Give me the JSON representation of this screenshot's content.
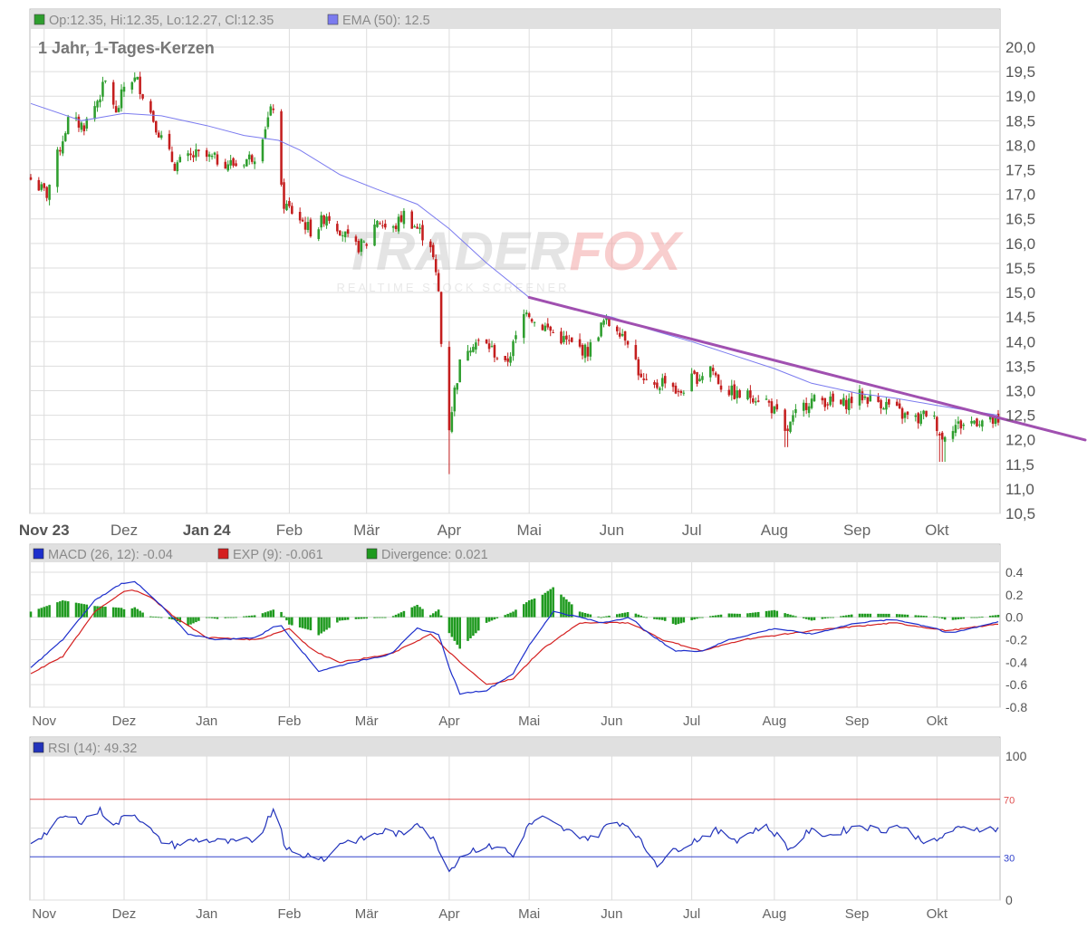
{
  "price_panel": {
    "legend_ohlc": "Op:12.35, Hi:12.35, Lo:12.27, Cl:12.35",
    "legend_ema": "EMA (50): 12.5",
    "subtitle": "1 Jahr, 1-Tages-Kerzen",
    "y_ticks": [
      "20,0",
      "19,5",
      "19,0",
      "18,5",
      "18,0",
      "17,5",
      "17,0",
      "16,5",
      "16,0",
      "15,5",
      "15,0",
      "14,5",
      "14,0",
      "13,5",
      "13,0",
      "12,5",
      "12,0",
      "11,5",
      "11,0",
      "10,5"
    ],
    "x_labels": [
      "Nov 23",
      "Dez",
      "Jan 24",
      "Feb",
      "Mär",
      "Apr",
      "Mai",
      "Jun",
      "Jul",
      "Aug",
      "Sep",
      "Okt"
    ]
  },
  "macd_panel": {
    "legend_macd": "MACD (26, 12): -0.04",
    "legend_exp": "EXP (9): -0.061",
    "legend_div": "Divergence: 0.021",
    "y_ticks": [
      "0.4",
      "0.2",
      "0.0",
      "-0.2",
      "-0.4",
      "-0.6",
      "-0.8"
    ],
    "x_labels": [
      "Nov",
      "Dez",
      "Jan",
      "Feb",
      "Mär",
      "Apr",
      "Mai",
      "Jun",
      "Jul",
      "Aug",
      "Sep",
      "Okt"
    ]
  },
  "rsi_panel": {
    "legend_rsi": "RSI (14): 49.32",
    "y_ticks": [
      "100",
      "70",
      "30",
      "0"
    ],
    "x_labels": [
      "Nov",
      "Dez",
      "Jan",
      "Feb",
      "Mär",
      "Apr",
      "Mai",
      "Jun",
      "Jul",
      "Aug",
      "Sep",
      "Okt"
    ]
  },
  "watermark": {
    "brand_a": "TRADER",
    "brand_b": "FOX",
    "tagline": "REALTIME STOCK SCREENER"
  },
  "colors": {
    "up": "#2e9e2e",
    "down": "#c41e1e",
    "ema": "#7b7bef",
    "trend": "#a050b0",
    "macd": "#1c2ecc",
    "exp": "#d42020",
    "divergence": "#1f9a1f",
    "rsi": "#2233bb",
    "rsi70": "#e05050",
    "rsi30": "#3344cc",
    "grid": "#dddddd",
    "legend_bg": "#e0e0e0"
  },
  "chart_data": [
    {
      "type": "candlestick",
      "subtitle": "1 Jahr, 1-Tages-Kerzen",
      "ylim": [
        10.5,
        20.0
      ],
      "x_range": [
        "2023-10-27",
        "2024-10-24"
      ],
      "x_ticks": [
        "2023-11-01",
        "2023-12-01",
        "2024-01-01",
        "2024-02-01",
        "2024-03-01",
        "2024-04-01",
        "2024-05-01",
        "2024-06-01",
        "2024-07-01",
        "2024-08-01",
        "2024-09-01",
        "2024-10-01"
      ],
      "anchors": [
        [
          "2023-10-27",
          17.3
        ],
        [
          "2023-11-02",
          17.0
        ],
        [
          "2023-11-05",
          17.6
        ],
        [
          "2023-11-10",
          18.5
        ],
        [
          "2023-11-16",
          18.4
        ],
        [
          "2023-11-20",
          18.8
        ],
        [
          "2023-11-25",
          19.4
        ],
        [
          "2023-11-28",
          18.6
        ],
        [
          "2023-12-02",
          19.4
        ],
        [
          "2023-12-06",
          19.3
        ],
        [
          "2023-12-10",
          18.8
        ],
        [
          "2023-12-16",
          18.0
        ],
        [
          "2023-12-20",
          17.6
        ],
        [
          "2023-12-28",
          17.8
        ],
        [
          "2024-01-05",
          17.7
        ],
        [
          "2024-01-12",
          17.6
        ],
        [
          "2024-01-19",
          17.8
        ],
        [
          "2024-01-23",
          18.4
        ],
        [
          "2024-01-26",
          18.8
        ],
        [
          "2024-01-27",
          17.6
        ],
        [
          "2024-01-30",
          16.8
        ],
        [
          "2024-02-05",
          16.5
        ],
        [
          "2024-02-10",
          16.2
        ],
        [
          "2024-02-15",
          16.6
        ],
        [
          "2024-02-20",
          16.3
        ],
        [
          "2024-02-25",
          15.9
        ],
        [
          "2024-03-01",
          16.0
        ],
        [
          "2024-03-05",
          16.5
        ],
        [
          "2024-03-10",
          16.2
        ],
        [
          "2024-03-15",
          16.6
        ],
        [
          "2024-03-20",
          16.3
        ],
        [
          "2024-03-25",
          16.0
        ],
        [
          "2024-03-28",
          15.0
        ],
        [
          "2024-03-31",
          11.9
        ],
        [
          "2024-04-03",
          13.0
        ],
        [
          "2024-04-06",
          13.8
        ],
        [
          "2024-04-10",
          14.0
        ],
        [
          "2024-04-16",
          13.9
        ],
        [
          "2024-04-22",
          13.5
        ],
        [
          "2024-04-27",
          14.2
        ],
        [
          "2024-04-30",
          14.7
        ],
        [
          "2024-05-03",
          14.4
        ],
        [
          "2024-05-07",
          14.3
        ],
        [
          "2024-05-12",
          14.1
        ],
        [
          "2024-05-18",
          13.9
        ],
        [
          "2024-05-23",
          13.8
        ],
        [
          "2024-05-29",
          14.4
        ],
        [
          "2024-06-03",
          14.3
        ],
        [
          "2024-06-08",
          14.0
        ],
        [
          "2024-06-12",
          13.2
        ],
        [
          "2024-06-16",
          13.0
        ],
        [
          "2024-06-22",
          13.3
        ],
        [
          "2024-06-26",
          12.9
        ],
        [
          "2024-06-30",
          13.2
        ],
        [
          "2024-07-04",
          13.3
        ],
        [
          "2024-07-08",
          13.5
        ],
        [
          "2024-07-12",
          13.1
        ],
        [
          "2024-07-18",
          12.9
        ],
        [
          "2024-07-24",
          12.9
        ],
        [
          "2024-07-29",
          12.8
        ],
        [
          "2024-08-02",
          12.5
        ],
        [
          "2024-08-05",
          12.1
        ],
        [
          "2024-08-09",
          12.5
        ],
        [
          "2024-08-14",
          12.8
        ],
        [
          "2024-08-20",
          12.8
        ],
        [
          "2024-08-26",
          12.7
        ],
        [
          "2024-09-02",
          12.9
        ],
        [
          "2024-09-08",
          12.8
        ],
        [
          "2024-09-13",
          12.7
        ],
        [
          "2024-09-18",
          12.5
        ],
        [
          "2024-09-24",
          12.4
        ],
        [
          "2024-09-28",
          12.6
        ],
        [
          "2024-10-01",
          12.3
        ],
        [
          "2024-10-03",
          12.0
        ],
        [
          "2024-10-05",
          12.3
        ],
        [
          "2024-10-10",
          12.3
        ],
        [
          "2024-10-16",
          12.4
        ],
        [
          "2024-10-24",
          12.35
        ]
      ],
      "ema": {
        "name": "EMA (50)",
        "points": [
          [
            "2023-10-27",
            18.85
          ],
          [
            "2023-11-15",
            18.5
          ],
          [
            "2023-12-01",
            18.65
          ],
          [
            "2023-12-15",
            18.6
          ],
          [
            "2024-01-01",
            18.4
          ],
          [
            "2024-01-15",
            18.2
          ],
          [
            "2024-01-28",
            18.1
          ],
          [
            "2024-02-05",
            17.9
          ],
          [
            "2024-02-20",
            17.4
          ],
          [
            "2024-03-05",
            17.1
          ],
          [
            "2024-03-20",
            16.8
          ],
          [
            "2024-04-01",
            16.3
          ],
          [
            "2024-04-15",
            15.6
          ],
          [
            "2024-05-01",
            14.9
          ],
          [
            "2024-05-15",
            14.7
          ],
          [
            "2024-06-01",
            14.5
          ],
          [
            "2024-06-15",
            14.25
          ],
          [
            "2024-07-01",
            14.0
          ],
          [
            "2024-07-15",
            13.75
          ],
          [
            "2024-08-01",
            13.45
          ],
          [
            "2024-08-15",
            13.15
          ],
          [
            "2024-09-01",
            12.95
          ],
          [
            "2024-09-15",
            12.85
          ],
          [
            "2024-10-01",
            12.7
          ],
          [
            "2024-10-24",
            12.5
          ]
        ]
      },
      "trendline": {
        "start": [
          "2024-05-01",
          14.9
        ],
        "end": [
          "2024-10-24",
          12.45
        ],
        "extends_right": true
      }
    },
    {
      "type": "line",
      "series": [
        {
          "name": "MACD (26, 12)",
          "points": [
            [
              "2023-10-27",
              -0.45
            ],
            [
              "2023-11-08",
              -0.2
            ],
            [
              "2023-11-20",
              0.15
            ],
            [
              "2023-11-30",
              0.3
            ],
            [
              "2023-12-05",
              0.32
            ],
            [
              "2023-12-15",
              0.1
            ],
            [
              "2023-12-25",
              -0.15
            ],
            [
              "2024-01-05",
              -0.2
            ],
            [
              "2024-01-20",
              -0.18
            ],
            [
              "2024-01-28",
              -0.05
            ],
            [
              "2024-02-05",
              -0.28
            ],
            [
              "2024-02-12",
              -0.48
            ],
            [
              "2024-02-25",
              -0.4
            ],
            [
              "2024-03-10",
              -0.33
            ],
            [
              "2024-03-20",
              -0.1
            ],
            [
              "2024-03-28",
              -0.15
            ],
            [
              "2024-04-01",
              -0.45
            ],
            [
              "2024-04-05",
              -0.68
            ],
            [
              "2024-04-15",
              -0.65
            ],
            [
              "2024-04-25",
              -0.5
            ],
            [
              "2024-05-01",
              -0.25
            ],
            [
              "2024-05-10",
              0.05
            ],
            [
              "2024-05-20",
              0.0
            ],
            [
              "2024-05-28",
              -0.05
            ],
            [
              "2024-06-08",
              0.0
            ],
            [
              "2024-06-15",
              -0.15
            ],
            [
              "2024-06-25",
              -0.3
            ],
            [
              "2024-07-05",
              -0.3
            ],
            [
              "2024-07-15",
              -0.2
            ],
            [
              "2024-08-01",
              -0.1
            ],
            [
              "2024-08-15",
              -0.15
            ],
            [
              "2024-09-01",
              -0.05
            ],
            [
              "2024-09-15",
              -0.02
            ],
            [
              "2024-10-01",
              -0.1
            ],
            [
              "2024-10-05",
              -0.15
            ],
            [
              "2024-10-24",
              -0.04
            ]
          ]
        },
        {
          "name": "EXP (9)",
          "points": [
            [
              "2023-10-27",
              -0.5
            ],
            [
              "2023-11-08",
              -0.35
            ],
            [
              "2023-11-20",
              0.05
            ],
            [
              "2023-12-02",
              0.25
            ],
            [
              "2023-12-10",
              0.2
            ],
            [
              "2023-12-20",
              0.0
            ],
            [
              "2024-01-01",
              -0.18
            ],
            [
              "2024-01-20",
              -0.2
            ],
            [
              "2024-02-01",
              -0.1
            ],
            [
              "2024-02-10",
              -0.3
            ],
            [
              "2024-02-20",
              -0.4
            ],
            [
              "2024-03-10",
              -0.33
            ],
            [
              "2024-03-25",
              -0.15
            ],
            [
              "2024-04-05",
              -0.4
            ],
            [
              "2024-04-15",
              -0.6
            ],
            [
              "2024-04-25",
              -0.55
            ],
            [
              "2024-05-05",
              -0.3
            ],
            [
              "2024-05-20",
              -0.05
            ],
            [
              "2024-06-08",
              -0.05
            ],
            [
              "2024-06-20",
              -0.2
            ],
            [
              "2024-07-05",
              -0.3
            ],
            [
              "2024-07-20",
              -0.2
            ],
            [
              "2024-08-15",
              -0.12
            ],
            [
              "2024-09-15",
              -0.05
            ],
            [
              "2024-10-05",
              -0.12
            ],
            [
              "2024-10-24",
              -0.061
            ]
          ]
        }
      ],
      "divergence": {
        "name": "Divergence",
        "values_follow": "MACD minus EXP"
      },
      "ylim": [
        -0.8,
        0.4
      ],
      "x_ticks": [
        "2023-11-01",
        "2023-12-01",
        "2024-01-01",
        "2024-02-01",
        "2024-03-01",
        "2024-04-01",
        "2024-05-01",
        "2024-06-01",
        "2024-07-01",
        "2024-08-01",
        "2024-09-01",
        "2024-10-01"
      ]
    },
    {
      "type": "line",
      "series": [
        {
          "name": "RSI (14)",
          "points": [
            [
              "2023-10-27",
              40
            ],
            [
              "2023-11-03",
              48
            ],
            [
              "2023-11-08",
              58
            ],
            [
              "2023-11-15",
              55
            ],
            [
              "2023-11-22",
              62
            ],
            [
              "2023-11-28",
              52
            ],
            [
              "2023-12-03",
              62
            ],
            [
              "2023-12-08",
              55
            ],
            [
              "2023-12-14",
              42
            ],
            [
              "2023-12-20",
              38
            ],
            [
              "2023-12-28",
              42
            ],
            [
              "2024-01-10",
              40
            ],
            [
              "2024-01-20",
              42
            ],
            [
              "2024-01-25",
              60
            ],
            [
              "2024-01-27",
              68
            ],
            [
              "2024-01-30",
              40
            ],
            [
              "2024-02-03",
              30
            ],
            [
              "2024-02-10",
              32
            ],
            [
              "2024-02-15",
              28
            ],
            [
              "2024-02-20",
              40
            ],
            [
              "2024-02-28",
              42
            ],
            [
              "2024-03-08",
              48
            ],
            [
              "2024-03-15",
              45
            ],
            [
              "2024-03-20",
              55
            ],
            [
              "2024-03-26",
              42
            ],
            [
              "2024-03-30",
              30
            ],
            [
              "2024-04-01",
              20
            ],
            [
              "2024-04-05",
              30
            ],
            [
              "2024-04-10",
              35
            ],
            [
              "2024-04-20",
              38
            ],
            [
              "2024-04-25",
              30
            ],
            [
              "2024-04-30",
              50
            ],
            [
              "2024-05-05",
              58
            ],
            [
              "2024-05-15",
              48
            ],
            [
              "2024-05-25",
              42
            ],
            [
              "2024-06-01",
              55
            ],
            [
              "2024-06-08",
              52
            ],
            [
              "2024-06-12",
              40
            ],
            [
              "2024-06-18",
              25
            ],
            [
              "2024-06-25",
              35
            ],
            [
              "2024-07-05",
              44
            ],
            [
              "2024-07-10",
              48
            ],
            [
              "2024-07-18",
              42
            ],
            [
              "2024-07-28",
              52
            ],
            [
              "2024-08-02",
              45
            ],
            [
              "2024-08-07",
              35
            ],
            [
              "2024-08-14",
              48
            ],
            [
              "2024-08-22",
              45
            ],
            [
              "2024-09-02",
              52
            ],
            [
              "2024-09-10",
              48
            ],
            [
              "2024-09-17",
              52
            ],
            [
              "2024-09-25",
              42
            ],
            [
              "2024-10-01",
              40
            ],
            [
              "2024-10-05",
              48
            ],
            [
              "2024-10-12",
              50
            ],
            [
              "2024-10-24",
              49.32
            ]
          ]
        }
      ],
      "levels": [
        70,
        30
      ],
      "ylim": [
        0,
        100
      ],
      "x_ticks": [
        "2023-11-01",
        "2023-12-01",
        "2024-01-01",
        "2024-02-01",
        "2024-03-01",
        "2024-04-01",
        "2024-05-01",
        "2024-06-01",
        "2024-07-01",
        "2024-08-01",
        "2024-09-01",
        "2024-10-01"
      ]
    }
  ]
}
